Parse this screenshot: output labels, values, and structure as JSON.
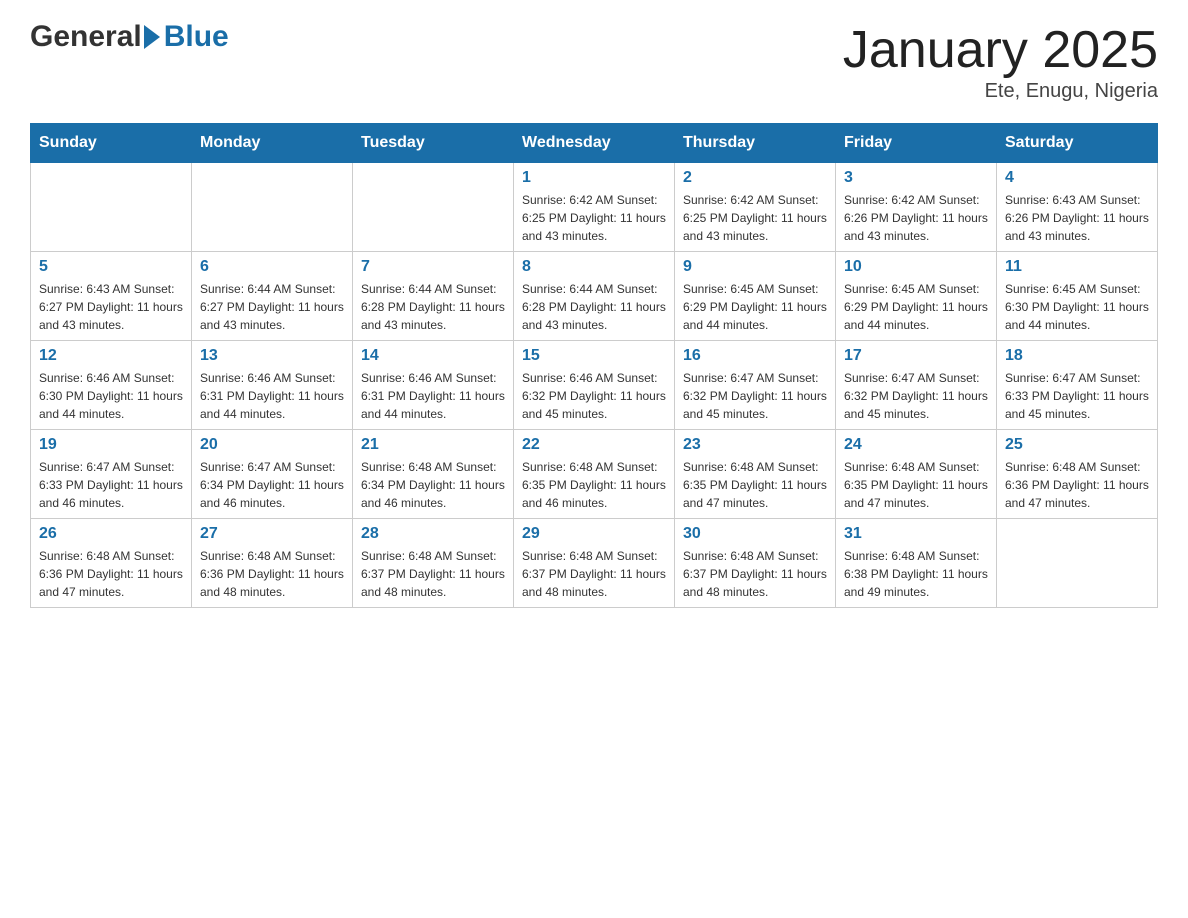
{
  "header": {
    "logo_general": "General",
    "logo_blue": "Blue",
    "month_title": "January 2025",
    "location": "Ete, Enugu, Nigeria"
  },
  "days_of_week": [
    "Sunday",
    "Monday",
    "Tuesday",
    "Wednesday",
    "Thursday",
    "Friday",
    "Saturday"
  ],
  "weeks": [
    [
      {
        "day": "",
        "info": ""
      },
      {
        "day": "",
        "info": ""
      },
      {
        "day": "",
        "info": ""
      },
      {
        "day": "1",
        "info": "Sunrise: 6:42 AM\nSunset: 6:25 PM\nDaylight: 11 hours and 43 minutes."
      },
      {
        "day": "2",
        "info": "Sunrise: 6:42 AM\nSunset: 6:25 PM\nDaylight: 11 hours and 43 minutes."
      },
      {
        "day": "3",
        "info": "Sunrise: 6:42 AM\nSunset: 6:26 PM\nDaylight: 11 hours and 43 minutes."
      },
      {
        "day": "4",
        "info": "Sunrise: 6:43 AM\nSunset: 6:26 PM\nDaylight: 11 hours and 43 minutes."
      }
    ],
    [
      {
        "day": "5",
        "info": "Sunrise: 6:43 AM\nSunset: 6:27 PM\nDaylight: 11 hours and 43 minutes."
      },
      {
        "day": "6",
        "info": "Sunrise: 6:44 AM\nSunset: 6:27 PM\nDaylight: 11 hours and 43 minutes."
      },
      {
        "day": "7",
        "info": "Sunrise: 6:44 AM\nSunset: 6:28 PM\nDaylight: 11 hours and 43 minutes."
      },
      {
        "day": "8",
        "info": "Sunrise: 6:44 AM\nSunset: 6:28 PM\nDaylight: 11 hours and 43 minutes."
      },
      {
        "day": "9",
        "info": "Sunrise: 6:45 AM\nSunset: 6:29 PM\nDaylight: 11 hours and 44 minutes."
      },
      {
        "day": "10",
        "info": "Sunrise: 6:45 AM\nSunset: 6:29 PM\nDaylight: 11 hours and 44 minutes."
      },
      {
        "day": "11",
        "info": "Sunrise: 6:45 AM\nSunset: 6:30 PM\nDaylight: 11 hours and 44 minutes."
      }
    ],
    [
      {
        "day": "12",
        "info": "Sunrise: 6:46 AM\nSunset: 6:30 PM\nDaylight: 11 hours and 44 minutes."
      },
      {
        "day": "13",
        "info": "Sunrise: 6:46 AM\nSunset: 6:31 PM\nDaylight: 11 hours and 44 minutes."
      },
      {
        "day": "14",
        "info": "Sunrise: 6:46 AM\nSunset: 6:31 PM\nDaylight: 11 hours and 44 minutes."
      },
      {
        "day": "15",
        "info": "Sunrise: 6:46 AM\nSunset: 6:32 PM\nDaylight: 11 hours and 45 minutes."
      },
      {
        "day": "16",
        "info": "Sunrise: 6:47 AM\nSunset: 6:32 PM\nDaylight: 11 hours and 45 minutes."
      },
      {
        "day": "17",
        "info": "Sunrise: 6:47 AM\nSunset: 6:32 PM\nDaylight: 11 hours and 45 minutes."
      },
      {
        "day": "18",
        "info": "Sunrise: 6:47 AM\nSunset: 6:33 PM\nDaylight: 11 hours and 45 minutes."
      }
    ],
    [
      {
        "day": "19",
        "info": "Sunrise: 6:47 AM\nSunset: 6:33 PM\nDaylight: 11 hours and 46 minutes."
      },
      {
        "day": "20",
        "info": "Sunrise: 6:47 AM\nSunset: 6:34 PM\nDaylight: 11 hours and 46 minutes."
      },
      {
        "day": "21",
        "info": "Sunrise: 6:48 AM\nSunset: 6:34 PM\nDaylight: 11 hours and 46 minutes."
      },
      {
        "day": "22",
        "info": "Sunrise: 6:48 AM\nSunset: 6:35 PM\nDaylight: 11 hours and 46 minutes."
      },
      {
        "day": "23",
        "info": "Sunrise: 6:48 AM\nSunset: 6:35 PM\nDaylight: 11 hours and 47 minutes."
      },
      {
        "day": "24",
        "info": "Sunrise: 6:48 AM\nSunset: 6:35 PM\nDaylight: 11 hours and 47 minutes."
      },
      {
        "day": "25",
        "info": "Sunrise: 6:48 AM\nSunset: 6:36 PM\nDaylight: 11 hours and 47 minutes."
      }
    ],
    [
      {
        "day": "26",
        "info": "Sunrise: 6:48 AM\nSunset: 6:36 PM\nDaylight: 11 hours and 47 minutes."
      },
      {
        "day": "27",
        "info": "Sunrise: 6:48 AM\nSunset: 6:36 PM\nDaylight: 11 hours and 48 minutes."
      },
      {
        "day": "28",
        "info": "Sunrise: 6:48 AM\nSunset: 6:37 PM\nDaylight: 11 hours and 48 minutes."
      },
      {
        "day": "29",
        "info": "Sunrise: 6:48 AM\nSunset: 6:37 PM\nDaylight: 11 hours and 48 minutes."
      },
      {
        "day": "30",
        "info": "Sunrise: 6:48 AM\nSunset: 6:37 PM\nDaylight: 11 hours and 48 minutes."
      },
      {
        "day": "31",
        "info": "Sunrise: 6:48 AM\nSunset: 6:38 PM\nDaylight: 11 hours and 49 minutes."
      },
      {
        "day": "",
        "info": ""
      }
    ]
  ]
}
